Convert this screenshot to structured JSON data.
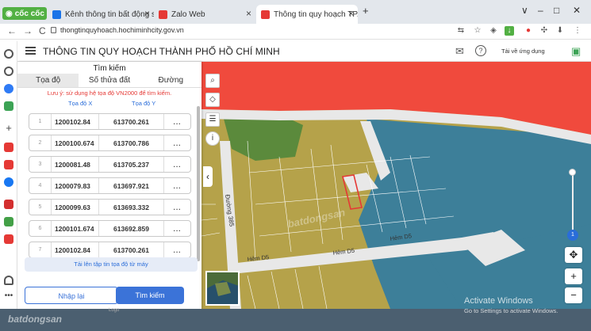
{
  "browser": {
    "brand": "cốc cốc",
    "tabs": [
      {
        "title": "Kênh thông tin bất động sản",
        "favicon_color": "#1a73e8",
        "active": false
      },
      {
        "title": "Zalo Web",
        "favicon_color": "#e53935",
        "active": false
      },
      {
        "title": "Thông tin quy hoạch TP.HCM",
        "favicon_color": "#e53935",
        "active": true
      }
    ],
    "new_tab": "+",
    "window_controls": [
      "∨",
      "–",
      "□",
      "✕"
    ],
    "url": "thongtinquyhoach.hochiminhcity.gov.vn",
    "nav": {
      "back": "←",
      "forward": "→",
      "reload": "C"
    }
  },
  "site": {
    "title": "THÔNG TIN QUY HOẠCH THÀNH PHỐ HỒ CHÍ MINH",
    "app_download": "Tải về ứng dụng"
  },
  "search_panel": {
    "title": "Tìm kiếm",
    "tabs": [
      "Tọa độ",
      "Số thửa đất",
      "Đường"
    ],
    "note": "Lưu ý: sử dụng hệ tọa độ VN2000 để tìm kiếm.",
    "col_x": "Tọa độ X",
    "col_y": "Tọa độ Y",
    "rows": [
      {
        "idx": "1",
        "x": "1200102.84",
        "y": "613700.261"
      },
      {
        "idx": "2",
        "x": "1200100.674",
        "y": "613700.786"
      },
      {
        "idx": "3",
        "x": "1200081.48",
        "y": "613705.237"
      },
      {
        "idx": "4",
        "x": "1200079.83",
        "y": "613697.921"
      },
      {
        "idx": "5",
        "x": "1200099.63",
        "y": "613693.332"
      },
      {
        "idx": "6",
        "x": "1200101.674",
        "y": "613692.859"
      },
      {
        "idx": "7",
        "x": "1200102.84",
        "y": "613700.261"
      }
    ],
    "row_menu": "...",
    "upload_label": "Tải lên tập tin tọa độ từ máy",
    "reset_label": "Nhập lại",
    "search_label": "Tìm kiếm"
  },
  "map": {
    "road_labels": [
      "Đường 385",
      "Hẻm D5",
      "Hẻm D5",
      "Hẻm D5"
    ],
    "watermark": "batdongsan",
    "zoom_level": "1",
    "zoom_in": "+",
    "zoom_out": "−",
    "colors": {
      "residential": "#b5a24a",
      "commercial": "#f04a3d",
      "water": "#3d7f99",
      "green": "#5b8a3c",
      "road": "#e8e8e8"
    }
  },
  "overlay": {
    "activate_title": "Activate Windows",
    "activate_sub": "Go to Settings to activate Windows.",
    "bottom_watermark": "batdongsan",
    "logo_text": "Logo"
  }
}
